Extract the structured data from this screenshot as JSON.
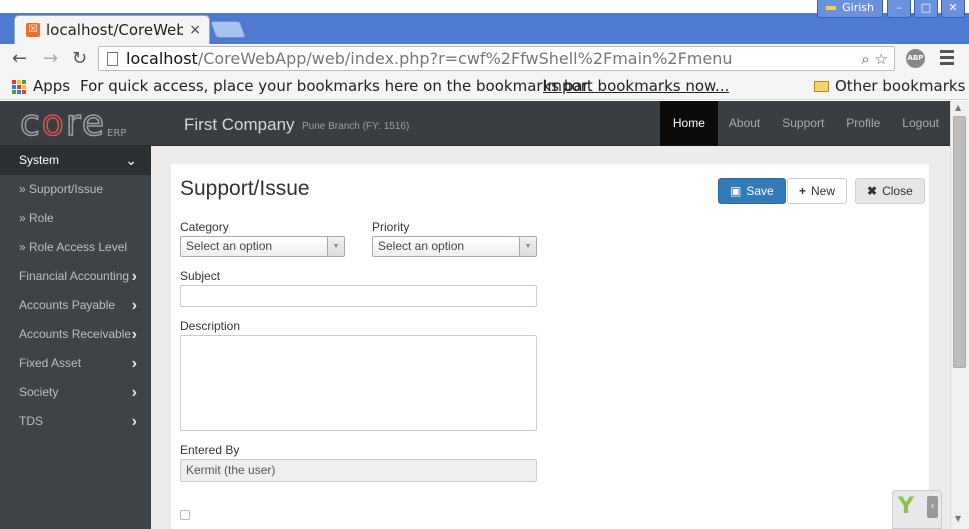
{
  "browser": {
    "tab_title": "localhost/CoreWebA",
    "tab_close": "×",
    "user_name": "Girish",
    "url_host": "localhost",
    "url_path": "/CoreWebApp/web/index.php?r=cwf%2FfwShell%2Fmain%2Fmenu",
    "abp_label": "ABP",
    "bookmarks": {
      "apps_label": "Apps",
      "hint": "For quick access, place your bookmarks here on the bookmarks bar.",
      "import_link": "Import bookmarks now...",
      "other_bookmarks": "Other bookmarks"
    }
  },
  "app": {
    "logo_text": "core",
    "logo_suffix": "ERP",
    "company": "First Company",
    "branch": "Pune Branch (FY: 1516)",
    "top_nav": [
      "Home",
      "About",
      "Support",
      "Profile",
      "Logout"
    ],
    "active_nav": "Home"
  },
  "sidebar": {
    "items": [
      {
        "label": "System",
        "type": "header",
        "icon": "chevron-down-icon"
      },
      {
        "label": "» Support/Issue",
        "type": "sub"
      },
      {
        "label": "» Role",
        "type": "sub"
      },
      {
        "label": "» Role Access Level",
        "type": "sub"
      },
      {
        "label": "Financial Accounting",
        "type": "group",
        "icon": "chevron-right-icon"
      },
      {
        "label": "Accounts Payable",
        "type": "group",
        "icon": "chevron-right-icon"
      },
      {
        "label": "Accounts Receivable",
        "type": "group",
        "icon": "chevron-right-icon"
      },
      {
        "label": "Fixed Asset",
        "type": "group",
        "icon": "chevron-right-icon"
      },
      {
        "label": "Society",
        "type": "group",
        "icon": "chevron-right-icon"
      },
      {
        "label": "TDS",
        "type": "group",
        "icon": "chevron-right-icon"
      }
    ]
  },
  "form": {
    "title": "Support/Issue",
    "buttons": {
      "save": "Save",
      "new": "New",
      "close": "Close"
    },
    "category_label": "Category",
    "category_value": "Select an option",
    "priority_label": "Priority",
    "priority_value": "Select an option",
    "subject_label": "Subject",
    "subject_value": "",
    "description_label": "Description",
    "description_value": "",
    "entered_by_label": "Entered By",
    "entered_by_value": "Kermit (the user)"
  },
  "colors": {
    "navbar": "#3a3d41",
    "sidebar": "#3d4347",
    "save_button": "#337ab7",
    "browser_frame": "#4f7ad1"
  }
}
